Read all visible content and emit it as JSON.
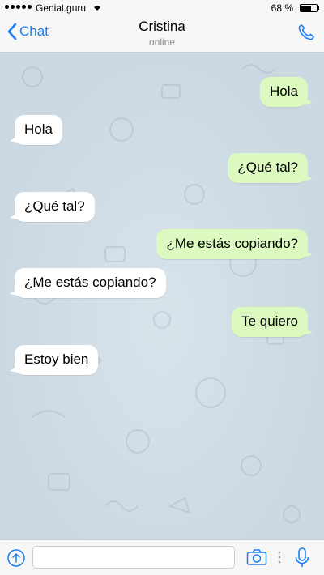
{
  "status_bar": {
    "carrier": "Genial.guru",
    "battery_percent": "68 %",
    "battery_level": 0.68,
    "icons": [
      "signal-dots-icon",
      "wifi-icon",
      "battery-icon"
    ]
  },
  "nav": {
    "back_label": "Chat",
    "title": "Cristina",
    "subtitle": "online",
    "icons": [
      "chevron-left-icon",
      "phone-icon"
    ]
  },
  "messages": [
    {
      "direction": "out",
      "text": "Hola"
    },
    {
      "direction": "in",
      "text": "Hola"
    },
    {
      "direction": "out",
      "text": "¿Qué tal?"
    },
    {
      "direction": "in",
      "text": "¿Qué tal?"
    },
    {
      "direction": "out",
      "text": "¿Me estás copiando?"
    },
    {
      "direction": "in",
      "text": "¿Me estás copiando?"
    },
    {
      "direction": "out",
      "text": "Te quiero"
    },
    {
      "direction": "in",
      "text": "Estoy bien"
    }
  ],
  "input_bar": {
    "value": "",
    "placeholder": "",
    "icons": [
      "attach-icon",
      "camera-icon",
      "more-dots-icon",
      "microphone-icon"
    ]
  },
  "colors": {
    "accent": "#1c7cf4",
    "outgoing_bubble": "#dcf9bf",
    "incoming_bubble": "#ffffff",
    "chat_background": "#ccd9e3"
  }
}
